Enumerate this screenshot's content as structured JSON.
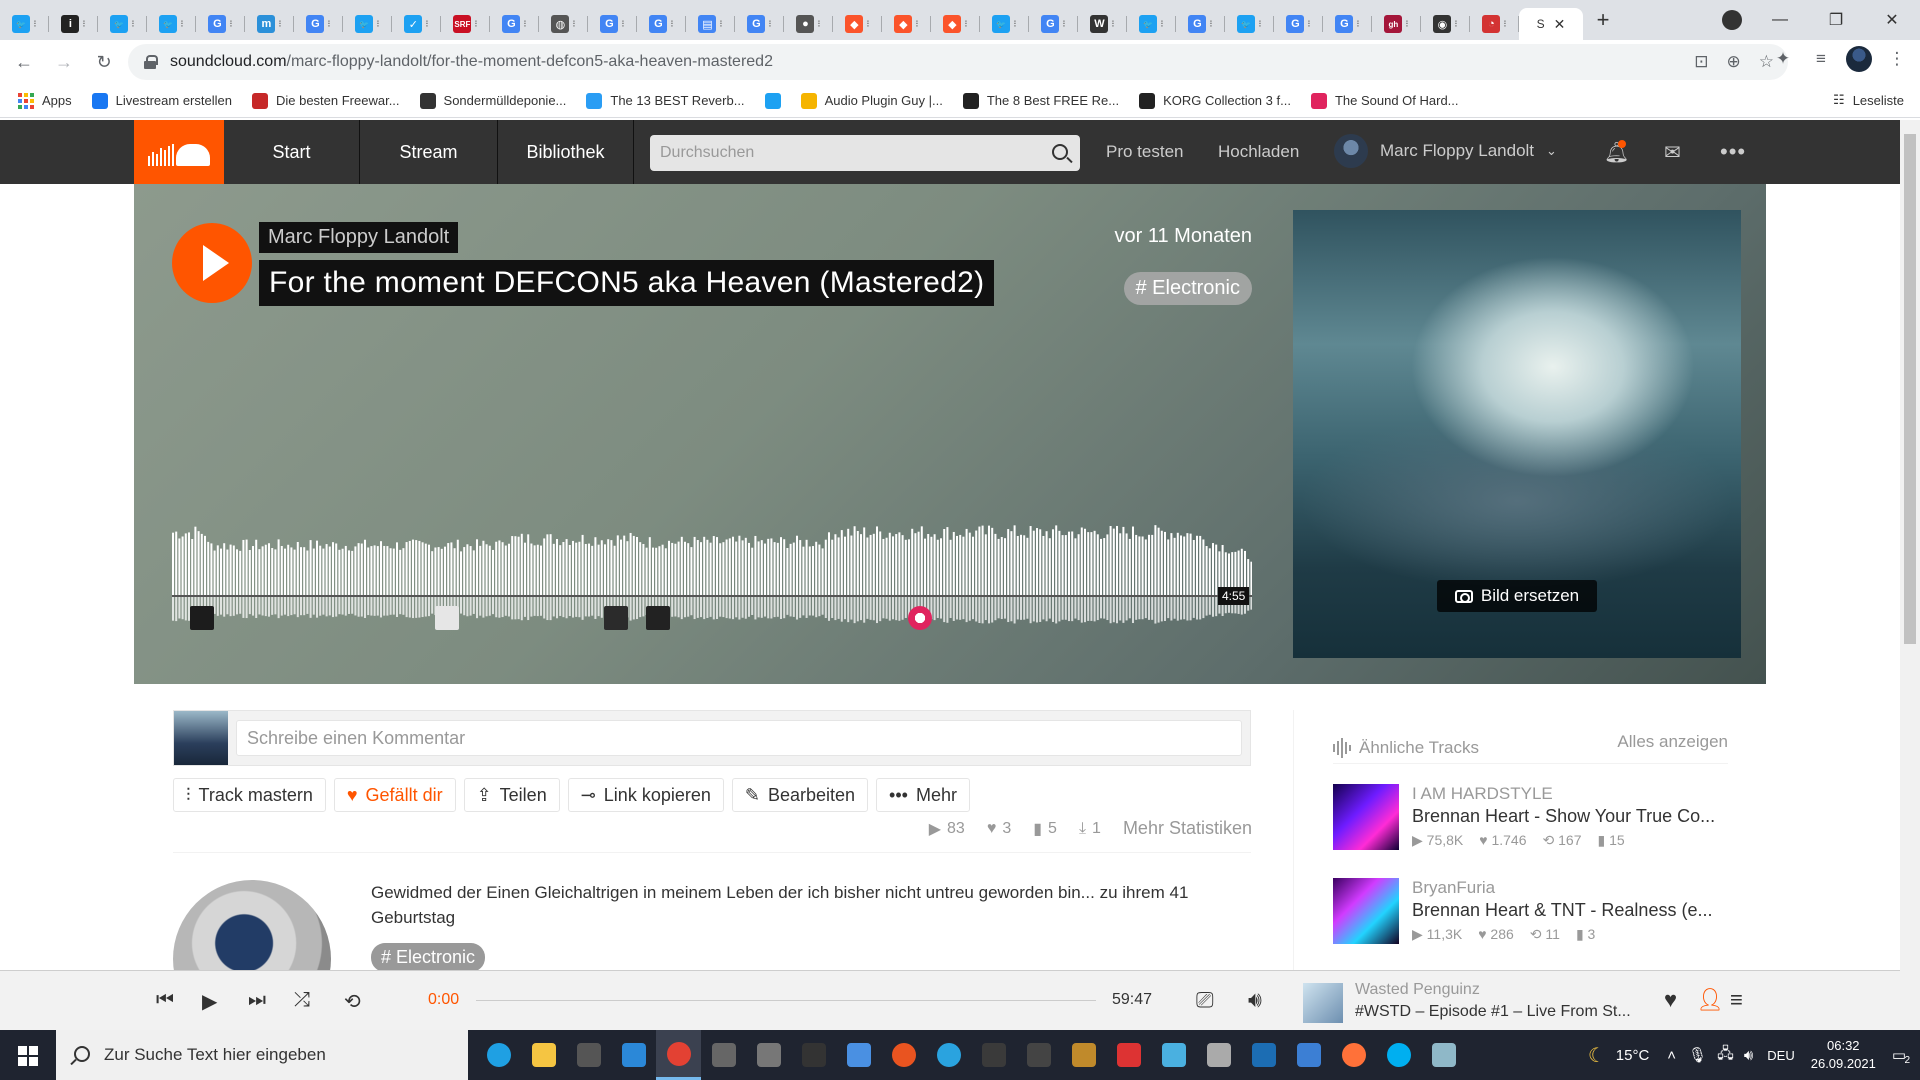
{
  "browser": {
    "tabs": [
      {
        "icon": "twitter-icon",
        "color": "#1da1f2",
        "glyph": "🐦"
      },
      {
        "icon": "info-icon",
        "color": "#222222",
        "glyph": "i"
      },
      {
        "icon": "twitter-icon",
        "color": "#1da1f2",
        "glyph": "🐦"
      },
      {
        "icon": "twitter-icon",
        "color": "#1da1f2",
        "glyph": "🐦"
      },
      {
        "icon": "google-icon",
        "color": "#4285f4",
        "glyph": "G"
      },
      {
        "icon": "mastodon-icon",
        "color": "#2b90d9",
        "glyph": "m"
      },
      {
        "icon": "google-icon",
        "color": "#4285f4",
        "glyph": "G"
      },
      {
        "icon": "twitter-icon",
        "color": "#1da1f2",
        "glyph": "🐦"
      },
      {
        "icon": "twitter-check-icon",
        "color": "#1da1f2",
        "glyph": "✓"
      },
      {
        "icon": "srf-icon",
        "color": "#c91024",
        "glyph": "SRF"
      },
      {
        "icon": "google-icon",
        "color": "#4285f4",
        "glyph": "G"
      },
      {
        "icon": "globe-icon",
        "color": "#555555",
        "glyph": "◍"
      },
      {
        "icon": "google-icon",
        "color": "#4285f4",
        "glyph": "G"
      },
      {
        "icon": "google-icon",
        "color": "#4285f4",
        "glyph": "G"
      },
      {
        "icon": "docs-icon",
        "color": "#4285f4",
        "glyph": "▤"
      },
      {
        "icon": "google-icon",
        "color": "#4285f4",
        "glyph": "G"
      },
      {
        "icon": "record-icon",
        "color": "#555555",
        "glyph": "●"
      },
      {
        "icon": "brave-icon",
        "color": "#fb542b",
        "glyph": "◆"
      },
      {
        "icon": "brave-icon",
        "color": "#fb542b",
        "glyph": "◆"
      },
      {
        "icon": "brave-icon",
        "color": "#fb542b",
        "glyph": "◆"
      },
      {
        "icon": "twitter-icon",
        "color": "#1da1f2",
        "glyph": "🐦"
      },
      {
        "icon": "google-icon",
        "color": "#4285f4",
        "glyph": "G"
      },
      {
        "icon": "wikipedia-icon",
        "color": "#333333",
        "glyph": "W"
      },
      {
        "icon": "twitter-icon",
        "color": "#1da1f2",
        "glyph": "🐦"
      },
      {
        "icon": "google-icon",
        "color": "#4285f4",
        "glyph": "G"
      },
      {
        "icon": "twitter-icon",
        "color": "#1da1f2",
        "glyph": "🐦"
      },
      {
        "icon": "google-icon",
        "color": "#4285f4",
        "glyph": "G"
      },
      {
        "icon": "google-icon",
        "color": "#4285f4",
        "glyph": "G"
      },
      {
        "icon": "gh-icon",
        "color": "#a4163a",
        "glyph": "gh"
      },
      {
        "icon": "github-icon",
        "color": "#333333",
        "glyph": "◉"
      },
      {
        "icon": "gauge-icon",
        "color": "#d33333",
        "glyph": "◔"
      }
    ],
    "active_tab": {
      "label": "S",
      "close": "✕"
    },
    "new_tab": "+",
    "url_host": "soundcloud.com",
    "url_path": "/marc-floppy-landolt/for-the-moment-defcon5-aka-heaven-mastered2"
  },
  "bookmarks": {
    "apps": "Apps",
    "items": [
      {
        "label": "Livestream erstellen",
        "color": "#1877f2"
      },
      {
        "label": "Die besten Freewar...",
        "color": "#c62828"
      },
      {
        "label": "Sondermülldeponie...",
        "color": "#333333"
      },
      {
        "label": "The 13 BEST Reverb...",
        "color": "#2a9df4"
      },
      {
        "label": "",
        "color": "#1da1f2"
      },
      {
        "label": "Audio Plugin Guy |...",
        "color": "#f5b400"
      },
      {
        "label": "The 8 Best FREE Re...",
        "color": "#222222"
      },
      {
        "label": "KORG Collection 3 f...",
        "color": "#222222"
      },
      {
        "label": "The Sound Of Hard...",
        "color": "#e0245e"
      }
    ],
    "reading_list": "Leseliste"
  },
  "sc_header": {
    "nav": [
      "Start",
      "Stream",
      "Bibliothek"
    ],
    "search_placeholder": "Durchsuchen",
    "pro": "Pro testen",
    "upload": "Hochladen",
    "user": "Marc Floppy Landolt"
  },
  "track": {
    "artist": "Marc Floppy Landolt",
    "title": "For the moment DEFCON5 aka Heaven (Mastered2)",
    "ago": "vor 11 Monaten",
    "genre": "# Electronic",
    "duration": "4:55",
    "replace_image": "Bild ersetzen",
    "accent": "#ff5500"
  },
  "comment": {
    "placeholder": "Schreibe einen Kommentar"
  },
  "actions": [
    {
      "name": "track-mastern-button",
      "label": "Track mastern",
      "icon": "sliders-icon",
      "glyph": "⫶"
    },
    {
      "name": "like-button",
      "label": "Gefällt dir",
      "icon": "heart-icon",
      "glyph": "♥"
    },
    {
      "name": "share-button",
      "label": "Teilen",
      "icon": "share-icon",
      "glyph": "⇪"
    },
    {
      "name": "copy-link-button",
      "label": "Link kopieren",
      "icon": "link-icon",
      "glyph": "⊸"
    },
    {
      "name": "edit-button",
      "label": "Bearbeiten",
      "icon": "pencil-icon",
      "glyph": "✎"
    },
    {
      "name": "more-button",
      "label": "Mehr",
      "icon": "more-icon",
      "glyph": "•••"
    }
  ],
  "stats": {
    "plays": "83",
    "likes": "3",
    "comments": "5",
    "downloads": "1",
    "more_stats": "Mehr Statistiken"
  },
  "description": {
    "text": "Gewidmed der Einen Gleichaltrigen in meinem Leben der ich bisher nicht untreu geworden bin... zu ihrem 41 Geburtstag",
    "tag": "# Electronic"
  },
  "related": {
    "heading": "Ähnliche Tracks",
    "view_all": "Alles anzeigen",
    "items": [
      {
        "user": "I AM HARDSTYLE",
        "title": "Brennan Heart - Show Your True Co...",
        "plays": "75,8K",
        "likes": "1.746",
        "reposts": "167",
        "comments": "15"
      },
      {
        "user": "BryanFuria",
        "title": "Brennan Heart & TNT - Realness (e...",
        "plays": "11,3K",
        "likes": "286",
        "reposts": "11",
        "comments": "3"
      }
    ]
  },
  "player": {
    "current": "0:00",
    "total": "59:47",
    "now_user": "Wasted Penguinz",
    "now_title": "#WSTD – Episode #1 – Live From St..."
  },
  "taskbar": {
    "search_placeholder": "Zur Suche Text hier eingeben",
    "temperature": "15°C",
    "language": "DEU",
    "time": "06:32",
    "date": "26.09.2021",
    "notifications": "2"
  }
}
